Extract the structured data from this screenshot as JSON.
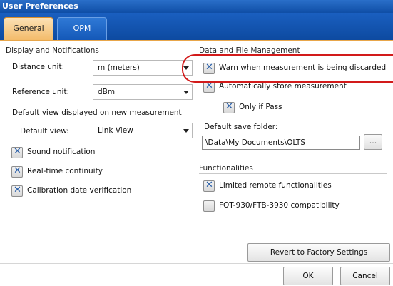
{
  "window": {
    "title": "User Preferences"
  },
  "tabs": [
    {
      "label": "General",
      "active": true
    },
    {
      "label": "OPM",
      "active": false
    }
  ],
  "display": {
    "section_title": "Display and Notifications",
    "distance_unit_label": "Distance unit:",
    "distance_unit_value": "m (meters)",
    "reference_unit_label": "Reference unit:",
    "reference_unit_value": "dBm",
    "default_view_caption": "Default view displayed on new measurement",
    "default_view_label": "Default view:",
    "default_view_value": "Link View",
    "checkboxes": [
      {
        "label": "Sound notification",
        "checked": true
      },
      {
        "label": "Real-time continuity",
        "checked": true
      },
      {
        "label": "Calibration date verification",
        "checked": true
      }
    ]
  },
  "data_file": {
    "section_title": "Data and File Management",
    "warn_discard": {
      "label": "Warn when measurement is being discarded",
      "checked": true
    },
    "auto_store": {
      "label": "Automatically store measurement",
      "checked": true
    },
    "only_if_pass": {
      "label": "Only if Pass",
      "checked": true
    },
    "save_folder_label": "Default save folder:",
    "save_folder_value": "\\Data\\My Documents\\OLTS",
    "browse_label": "..."
  },
  "functionalities": {
    "section_title": "Functionalities",
    "limited_remote": {
      "label": "Limited remote functionalities",
      "checked": true
    },
    "compat": {
      "label": "FOT-930/FTB-3930 compatibility",
      "checked": false
    }
  },
  "buttons": {
    "revert": "Revert to Factory Settings",
    "ok": "OK",
    "cancel": "Cancel"
  },
  "colors": {
    "title_bar": "#0f4ea6",
    "active_tab": "#f3bb6a",
    "highlight": "#d21a1a",
    "check_mark": "#2a5fa8"
  }
}
